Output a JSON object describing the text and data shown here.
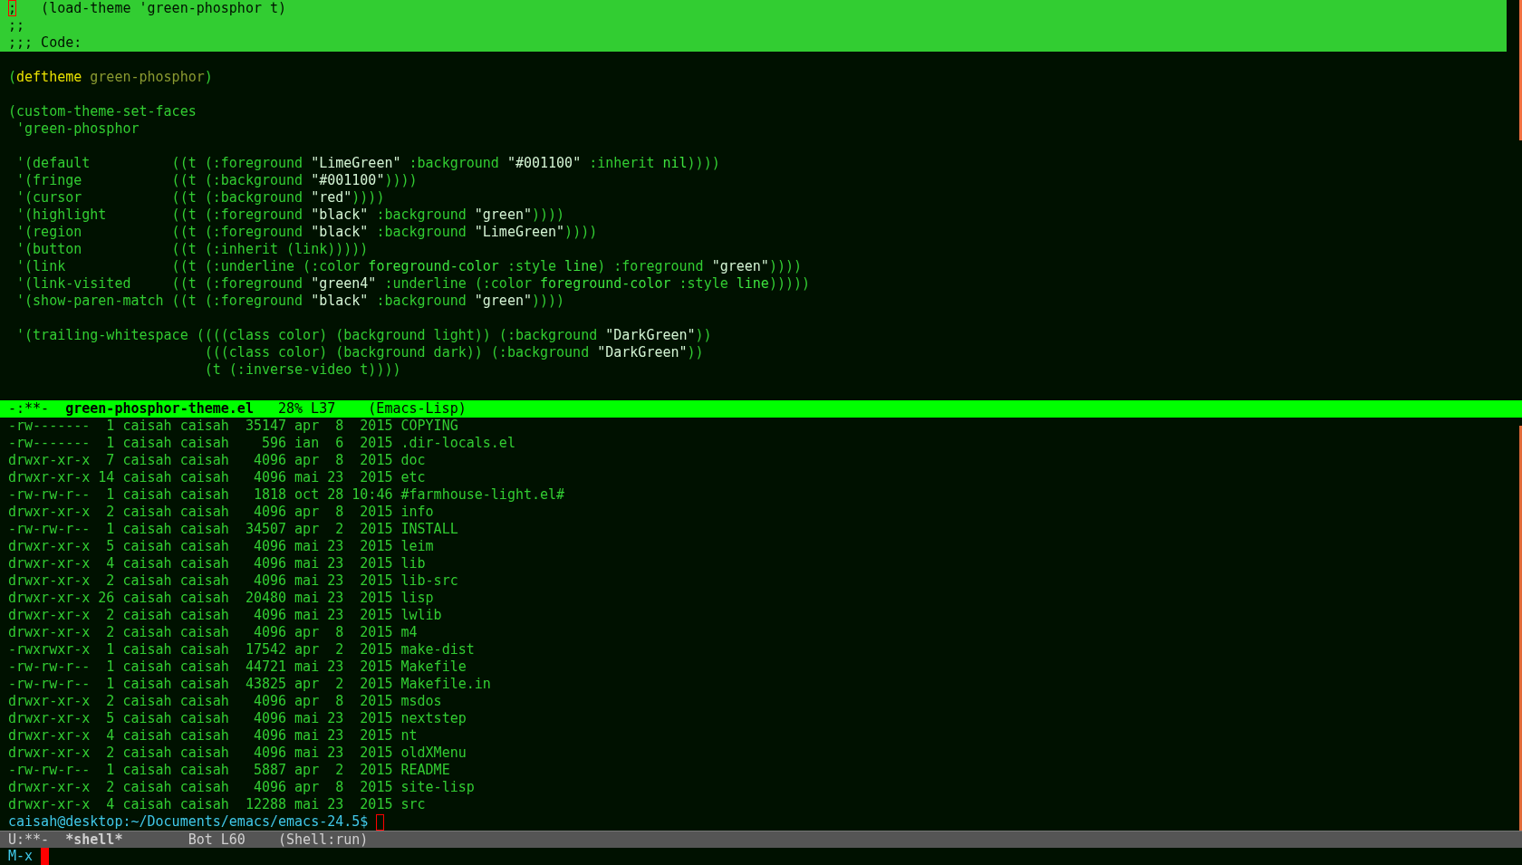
{
  "editor": {
    "region_lines": [
      {
        "segments": [
          {
            "text": ";",
            "kind": "cursor"
          },
          {
            "text": "   (load-theme 'green-phosphor t)",
            "kind": "plain"
          }
        ]
      },
      {
        "segments": [
          {
            "text": ";;",
            "kind": "plain"
          }
        ]
      },
      {
        "segments": [
          {
            "text": ";;; Code:",
            "kind": "plain"
          }
        ]
      }
    ],
    "lines": [
      {
        "kind": "blank"
      },
      {
        "kind": "code",
        "segments": [
          {
            "text": "(",
            "kind": "plain"
          },
          {
            "text": "deftheme",
            "kind": "keyword"
          },
          {
            "text": " green-phosphor",
            "kind": "name"
          },
          {
            "text": ")",
            "kind": "plain"
          }
        ]
      },
      {
        "kind": "blank"
      },
      {
        "kind": "code",
        "segments": [
          {
            "text": "(custom-theme-set-faces",
            "kind": "plain"
          }
        ]
      },
      {
        "kind": "code",
        "segments": [
          {
            "text": " 'green-phosphor",
            "kind": "plain"
          }
        ]
      },
      {
        "kind": "blank"
      },
      {
        "kind": "code",
        "segments": [
          {
            "text": " '(default          ((t (:foreground ",
            "kind": "plain"
          },
          {
            "text": "\"LimeGreen\"",
            "kind": "string"
          },
          {
            "text": " :background ",
            "kind": "plain"
          },
          {
            "text": "\"#001100\"",
            "kind": "string"
          },
          {
            "text": " :inherit ",
            "kind": "plain"
          },
          {
            "text": "nil",
            "kind": "constant"
          },
          {
            "text": "))))",
            "kind": "plain"
          }
        ]
      },
      {
        "kind": "code",
        "segments": [
          {
            "text": " '(fringe           ((t (:background ",
            "kind": "plain"
          },
          {
            "text": "\"#001100\"",
            "kind": "string"
          },
          {
            "text": "))))",
            "kind": "plain"
          }
        ]
      },
      {
        "kind": "code",
        "segments": [
          {
            "text": " '(cursor           ((t (:background ",
            "kind": "plain"
          },
          {
            "text": "\"red\"",
            "kind": "string"
          },
          {
            "text": "))))",
            "kind": "plain"
          }
        ]
      },
      {
        "kind": "code",
        "segments": [
          {
            "text": " '(highlight        ((t (:foreground ",
            "kind": "plain"
          },
          {
            "text": "\"black\"",
            "kind": "string"
          },
          {
            "text": " :background ",
            "kind": "plain"
          },
          {
            "text": "\"green\"",
            "kind": "string"
          },
          {
            "text": "))))",
            "kind": "plain"
          }
        ]
      },
      {
        "kind": "code",
        "segments": [
          {
            "text": " '(region           ((t (:foreground ",
            "kind": "plain"
          },
          {
            "text": "\"black\"",
            "kind": "string"
          },
          {
            "text": " :background ",
            "kind": "plain"
          },
          {
            "text": "\"LimeGreen\"",
            "kind": "string"
          },
          {
            "text": "))))",
            "kind": "plain"
          }
        ]
      },
      {
        "kind": "code",
        "segments": [
          {
            "text": " '(button           ((t (:inherit (link)))))",
            "kind": "plain"
          }
        ]
      },
      {
        "kind": "code",
        "segments": [
          {
            "text": " '(link             ((t (:underline (:color ",
            "kind": "plain"
          },
          {
            "text": "foreground-color",
            "kind": "constant"
          },
          {
            "text": " :style ",
            "kind": "plain"
          },
          {
            "text": "line",
            "kind": "constant"
          },
          {
            "text": ") :foreground ",
            "kind": "plain"
          },
          {
            "text": "\"green\"",
            "kind": "string"
          },
          {
            "text": "))))",
            "kind": "plain"
          }
        ]
      },
      {
        "kind": "code",
        "segments": [
          {
            "text": " '(link-visited     ((t (:foreground ",
            "kind": "plain"
          },
          {
            "text": "\"green4\"",
            "kind": "string"
          },
          {
            "text": " :underline (:color ",
            "kind": "plain"
          },
          {
            "text": "foreground-color",
            "kind": "constant"
          },
          {
            "text": " :style ",
            "kind": "plain"
          },
          {
            "text": "line",
            "kind": "constant"
          },
          {
            "text": ")))))",
            "kind": "plain"
          }
        ]
      },
      {
        "kind": "code",
        "segments": [
          {
            "text": " '(show-paren-match ((t (:foreground ",
            "kind": "plain"
          },
          {
            "text": "\"black\"",
            "kind": "string"
          },
          {
            "text": " :background ",
            "kind": "plain"
          },
          {
            "text": "\"green\"",
            "kind": "string"
          },
          {
            "text": "))))",
            "kind": "plain"
          }
        ]
      },
      {
        "kind": "blank"
      },
      {
        "kind": "code",
        "segments": [
          {
            "text": " '(trailing-whitespace ((((class color) (background light)) (:background ",
            "kind": "plain"
          },
          {
            "text": "\"DarkGreen\"",
            "kind": "string"
          },
          {
            "text": "))",
            "kind": "plain"
          }
        ]
      },
      {
        "kind": "code",
        "segments": [
          {
            "text": "                        (((class color) (background dark)) (:background ",
            "kind": "plain"
          },
          {
            "text": "\"DarkGreen\"",
            "kind": "string"
          },
          {
            "text": "))",
            "kind": "plain"
          }
        ]
      },
      {
        "kind": "code",
        "segments": [
          {
            "text": "                        (t (:inverse-video t))))",
            "kind": "plain"
          }
        ]
      }
    ],
    "mode_line": {
      "active": true,
      "status": "-:**-",
      "buffer": "green-phosphor-theme.el",
      "position": "28% L37",
      "mode": "(Emacs-Lisp)"
    }
  },
  "shell": {
    "lines": [
      "-rw-------  1 caisah caisah  35147 apr  8  2015 COPYING",
      "-rw-------  1 caisah caisah    596 ian  6  2015 .dir-locals.el",
      "drwxr-xr-x  7 caisah caisah   4096 apr  8  2015 doc",
      "drwxr-xr-x 14 caisah caisah   4096 mai 23  2015 etc",
      "-rw-rw-r--  1 caisah caisah   1818 oct 28 10:46 #farmhouse-light.el#",
      "drwxr-xr-x  2 caisah caisah   4096 apr  8  2015 info",
      "-rw-rw-r--  1 caisah caisah  34507 apr  2  2015 INSTALL",
      "drwxr-xr-x  5 caisah caisah   4096 mai 23  2015 leim",
      "drwxr-xr-x  4 caisah caisah   4096 mai 23  2015 lib",
      "drwxr-xr-x  2 caisah caisah   4096 mai 23  2015 lib-src",
      "drwxr-xr-x 26 caisah caisah  20480 mai 23  2015 lisp",
      "drwxr-xr-x  2 caisah caisah   4096 mai 23  2015 lwlib",
      "drwxr-xr-x  2 caisah caisah   4096 apr  8  2015 m4",
      "-rwxrwxr-x  1 caisah caisah  17542 apr  2  2015 make-dist",
      "-rw-rw-r--  1 caisah caisah  44721 mai 23  2015 Makefile",
      "-rw-rw-r--  1 caisah caisah  43825 apr  2  2015 Makefile.in",
      "drwxr-xr-x  2 caisah caisah   4096 apr  8  2015 msdos",
      "drwxr-xr-x  5 caisah caisah   4096 mai 23  2015 nextstep",
      "drwxr-xr-x  4 caisah caisah   4096 mai 23  2015 nt",
      "drwxr-xr-x  2 caisah caisah   4096 mai 23  2015 oldXMenu",
      "-rw-rw-r--  1 caisah caisah   5887 apr  2  2015 README",
      "drwxr-xr-x  2 caisah caisah   4096 apr  8  2015 site-lisp",
      "drwxr-xr-x  4 caisah caisah  12288 mai 23  2015 src"
    ],
    "prompt": {
      "text": "caisah@desktop:~/Documents/emacs/emacs-24.5$",
      "cursor": true
    },
    "mode_line": {
      "active": false,
      "status": "U:**-",
      "buffer": "*shell*",
      "position": "Bot L60",
      "mode": "(Shell:run)"
    }
  },
  "minibuffer": {
    "prompt": "M-x",
    "cursor": true
  }
}
